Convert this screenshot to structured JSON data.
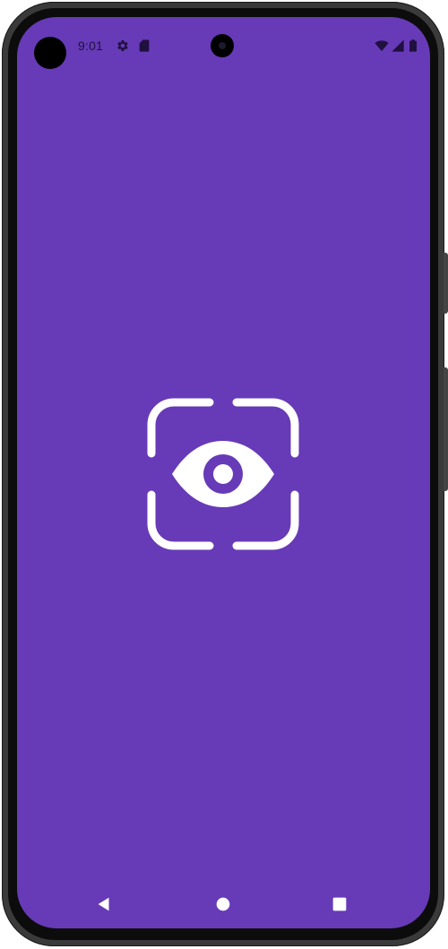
{
  "status_bar": {
    "time": "9:01",
    "icons": [
      "settings-icon",
      "sim-card-icon",
      "wifi-icon",
      "cellular-signal-icon",
      "battery-icon"
    ]
  },
  "app": {
    "splash_icon": "eye-scan-icon",
    "background_color": "#673ab7",
    "icon_color": "#ffffff"
  },
  "navigation_bar": {
    "buttons": [
      "back-button",
      "home-button",
      "recents-button"
    ]
  }
}
